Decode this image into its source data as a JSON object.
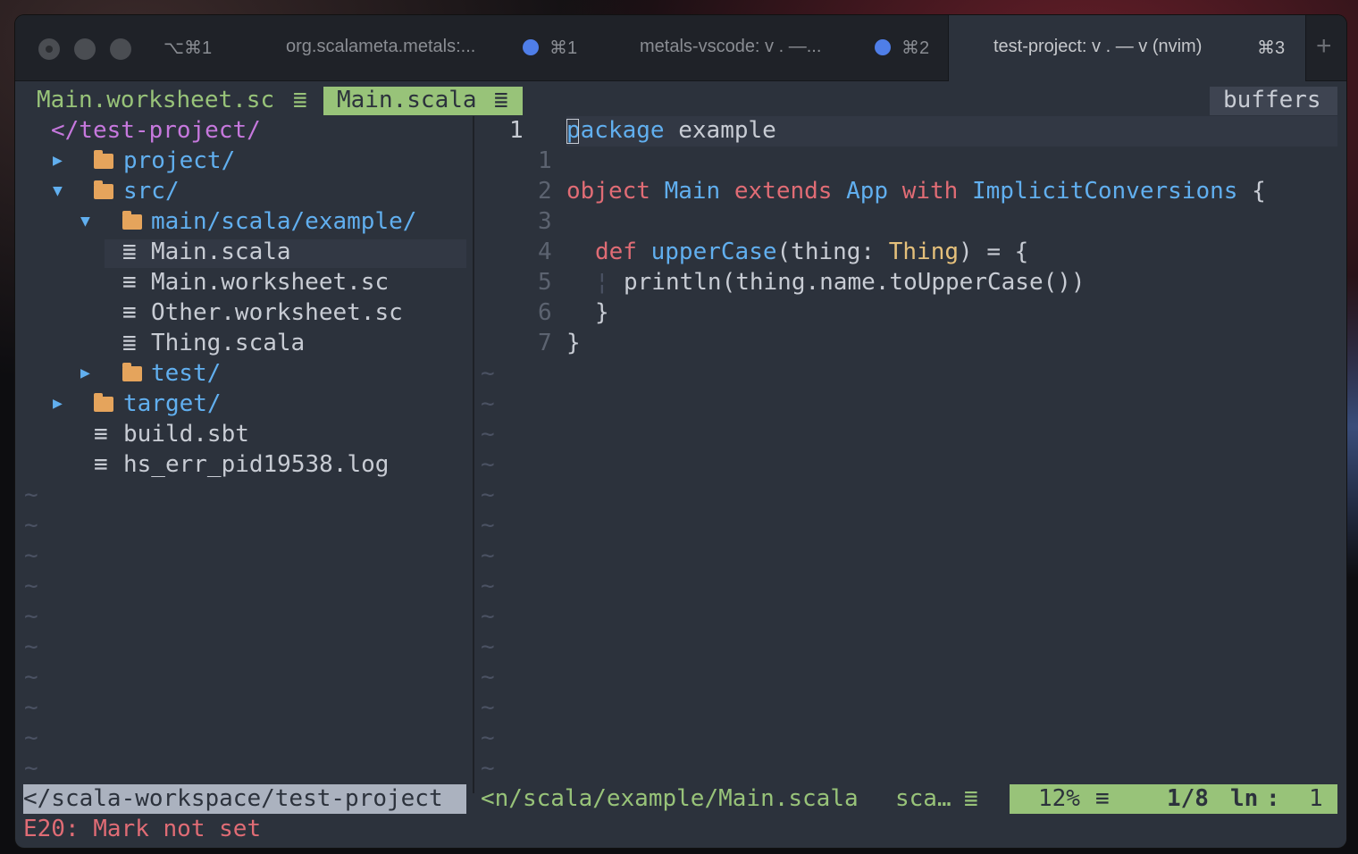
{
  "titlebar": {
    "tab1_shortcut": "⌥⌘1",
    "tab2_title": "org.scalameta.metals:...",
    "tab2_shortcut": "⌘1",
    "tab3_title": "metals-vscode: v . —...",
    "tab3_shortcut": "⌘2",
    "tab4_title": "test-project: v . — v (nvim)",
    "tab4_shortcut": "⌘3",
    "new_tab": "+"
  },
  "buffers": {
    "tab1": "Main.worksheet.sc",
    "tab2": "Main.scala",
    "label": "buffers"
  },
  "tree": {
    "root": "</test-project/",
    "items": [
      {
        "arrow": "▶",
        "name": "project/",
        "type": "folder"
      },
      {
        "arrow": "▼",
        "name": "src/",
        "type": "folder"
      },
      {
        "arrow": "▼",
        "name": "main/scala/example/",
        "type": "folder"
      },
      {
        "arrow": "",
        "name": "Main.scala",
        "type": "scala"
      },
      {
        "arrow": "",
        "name": "Main.worksheet.sc",
        "type": "text"
      },
      {
        "arrow": "",
        "name": "Other.worksheet.sc",
        "type": "text"
      },
      {
        "arrow": "",
        "name": "Thing.scala",
        "type": "scala"
      },
      {
        "arrow": "▶",
        "name": "test/",
        "type": "folder"
      },
      {
        "arrow": "▶",
        "name": "target/",
        "type": "folder"
      },
      {
        "arrow": "",
        "name": "build.sbt",
        "type": "text"
      },
      {
        "arrow": "",
        "name": "hs_err_pid19538.log",
        "type": "text"
      }
    ]
  },
  "code": {
    "line_numbers": [
      "1",
      "1",
      "2",
      "3",
      "4",
      "5",
      "6",
      "7"
    ],
    "line0_kw": "package",
    "line0_rest": " example",
    "line2": [
      "object",
      "Main",
      "extends",
      "App",
      "with",
      "ImplicitConversions",
      "{"
    ],
    "line4": [
      "def",
      "upperCase",
      "(thing: ",
      "Thing",
      ") = {"
    ],
    "line5": "println(thing.name.toUpperCase())",
    "line6": "}",
    "line7": "}"
  },
  "statusline": {
    "left_path": "</scala-workspace/test-project",
    "file_path": "<n/scala/example/Main.scala",
    "filetype": "sca…",
    "percent": "12%",
    "position": "1/8",
    "ln": "ln",
    "col": "1"
  },
  "message": "E20: Mark not set"
}
